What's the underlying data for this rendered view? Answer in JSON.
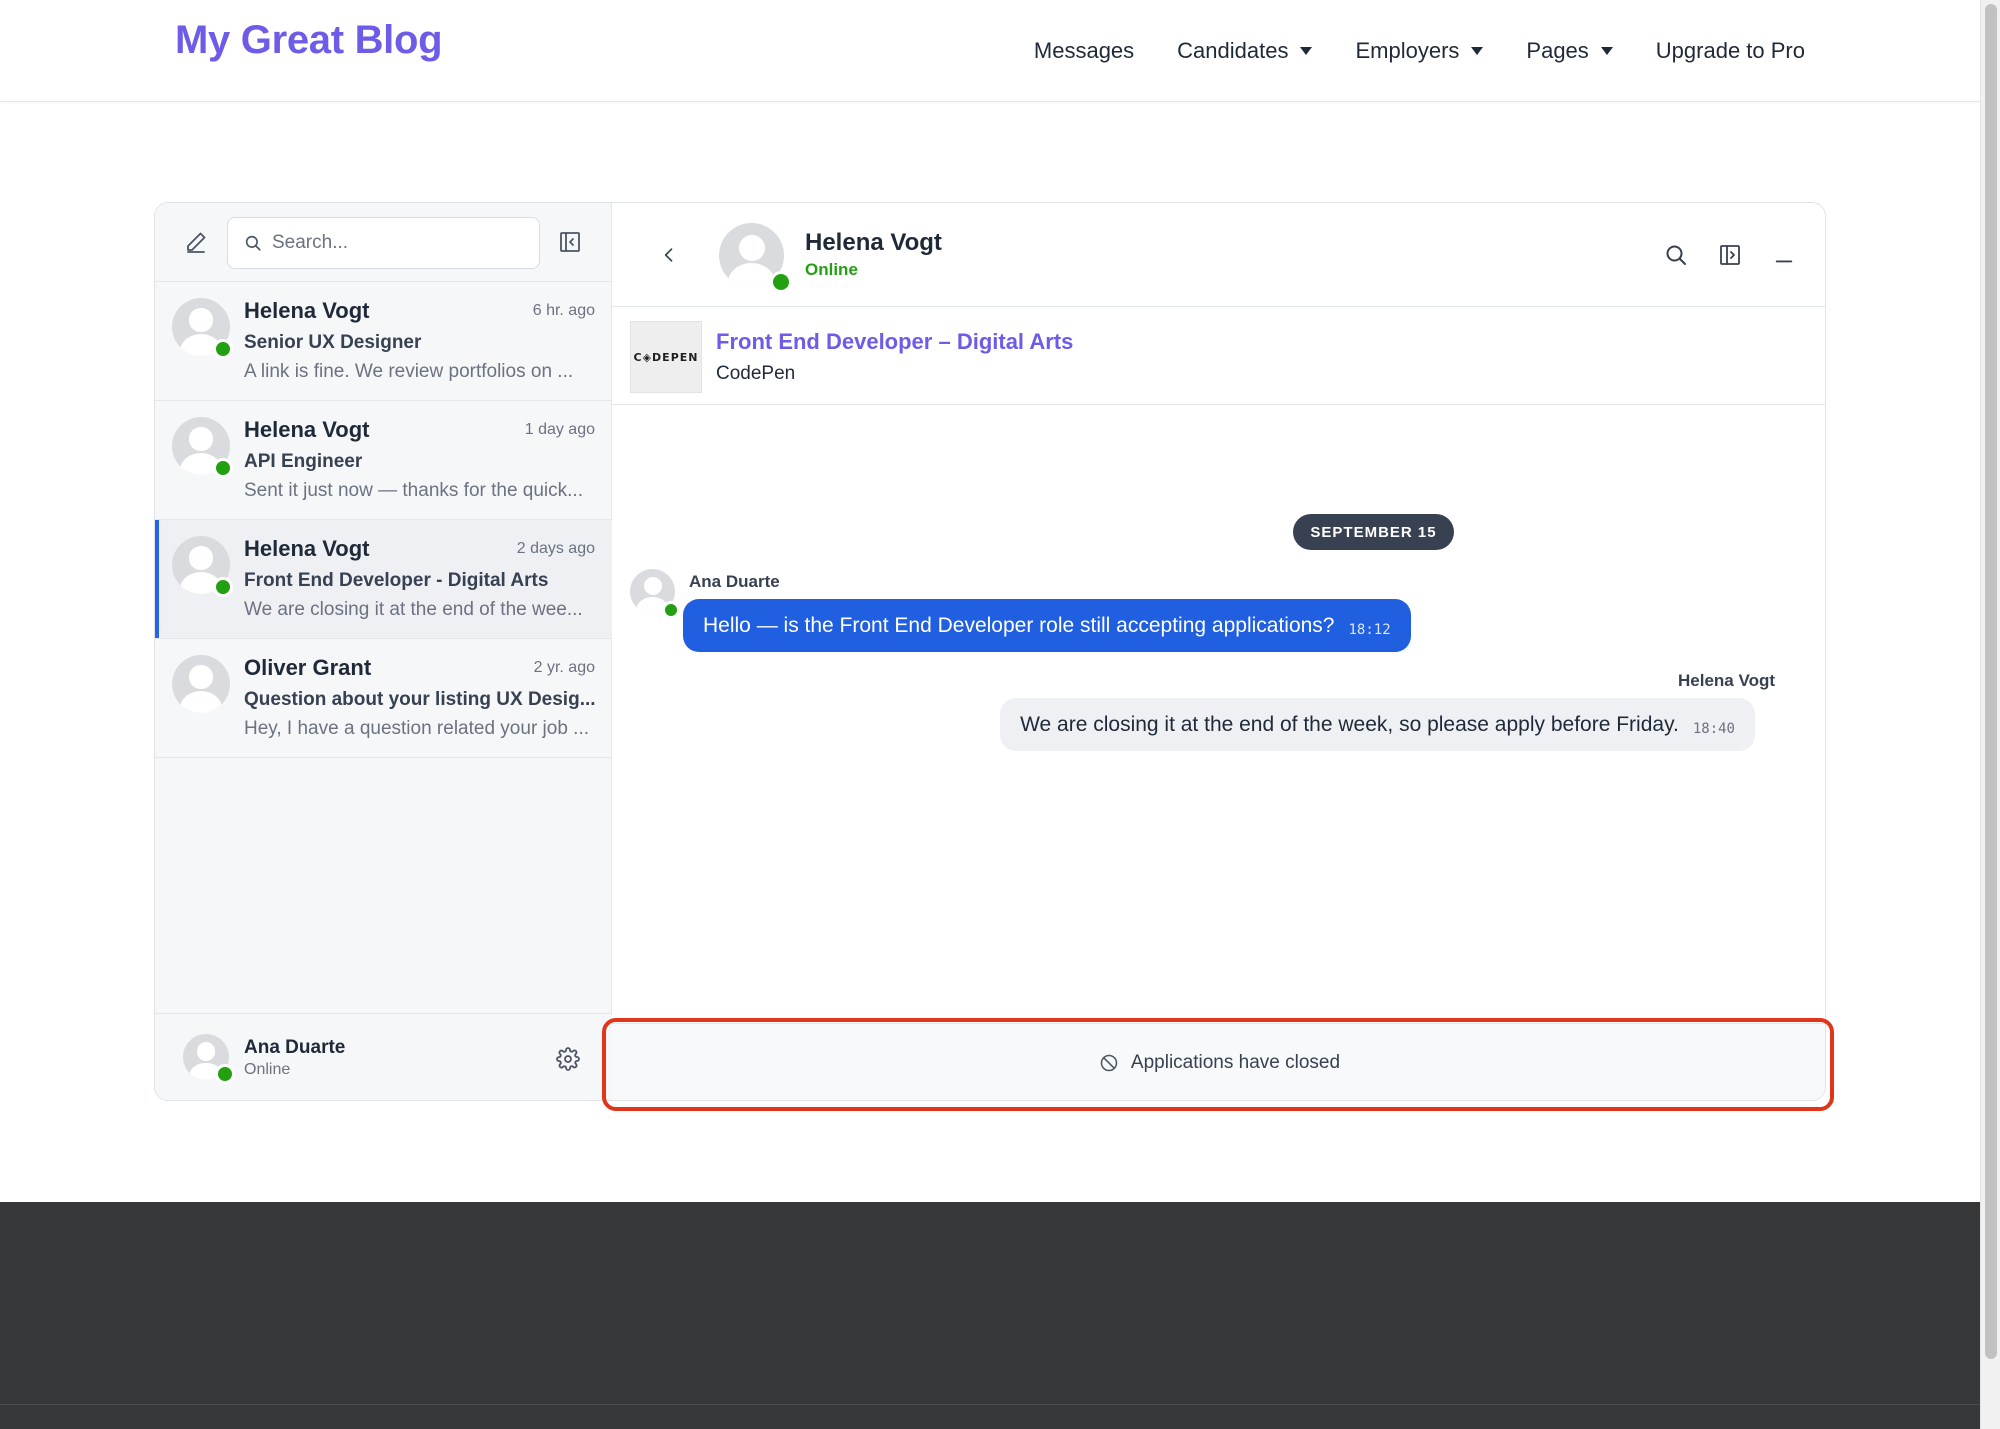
{
  "brand": "My Great Blog",
  "nav": {
    "messages": "Messages",
    "candidates": "Candidates",
    "employers": "Employers",
    "pages": "Pages",
    "upgrade": "Upgrade to Pro"
  },
  "sidebar": {
    "search_placeholder": "Search...",
    "conversations": [
      {
        "name": "Helena Vogt",
        "time": "6 hr. ago",
        "subject": "Senior UX Designer",
        "preview": "A link is fine. We review portfolios on ...",
        "online": true,
        "active": false
      },
      {
        "name": "Helena Vogt",
        "time": "1 day ago",
        "subject": "API Engineer",
        "preview": "Sent it just now — thanks for the quick...",
        "online": true,
        "active": false
      },
      {
        "name": "Helena Vogt",
        "time": "2 days ago",
        "subject": "Front End Developer - Digital Arts",
        "preview": "We are closing it at the end of the wee...",
        "online": true,
        "active": true
      },
      {
        "name": "Oliver Grant",
        "time": "2 yr. ago",
        "subject": "Question about your listing UX Desig...",
        "preview": "Hey, I have a question related your job ...",
        "online": false,
        "active": false
      }
    ],
    "me": {
      "name": "Ana Duarte",
      "status": "Online"
    }
  },
  "chat": {
    "contact_name": "Helena Vogt",
    "contact_status": "Online",
    "job": {
      "title": "Front End Developer – Digital Arts",
      "company": "CodePen",
      "logo_text": "C◈DEPEN"
    },
    "date_divider": "SEPTEMBER 15",
    "messages": [
      {
        "sender": "Ana Duarte",
        "text": "Hello — is the Front End Developer role still accepting applications?",
        "time": "18:12",
        "mine": true
      },
      {
        "sender": "Helena Vogt",
        "text": "We are closing it at the end of the week, so please apply before Friday.",
        "time": "18:40",
        "mine": false
      }
    ],
    "closed_notice": "Applications have closed"
  },
  "colors": {
    "brand": "#6c5ce7",
    "online": "#22a012",
    "accent_blue": "#1f5fe0",
    "highlight": "#e0341b",
    "footer": "#363739"
  }
}
